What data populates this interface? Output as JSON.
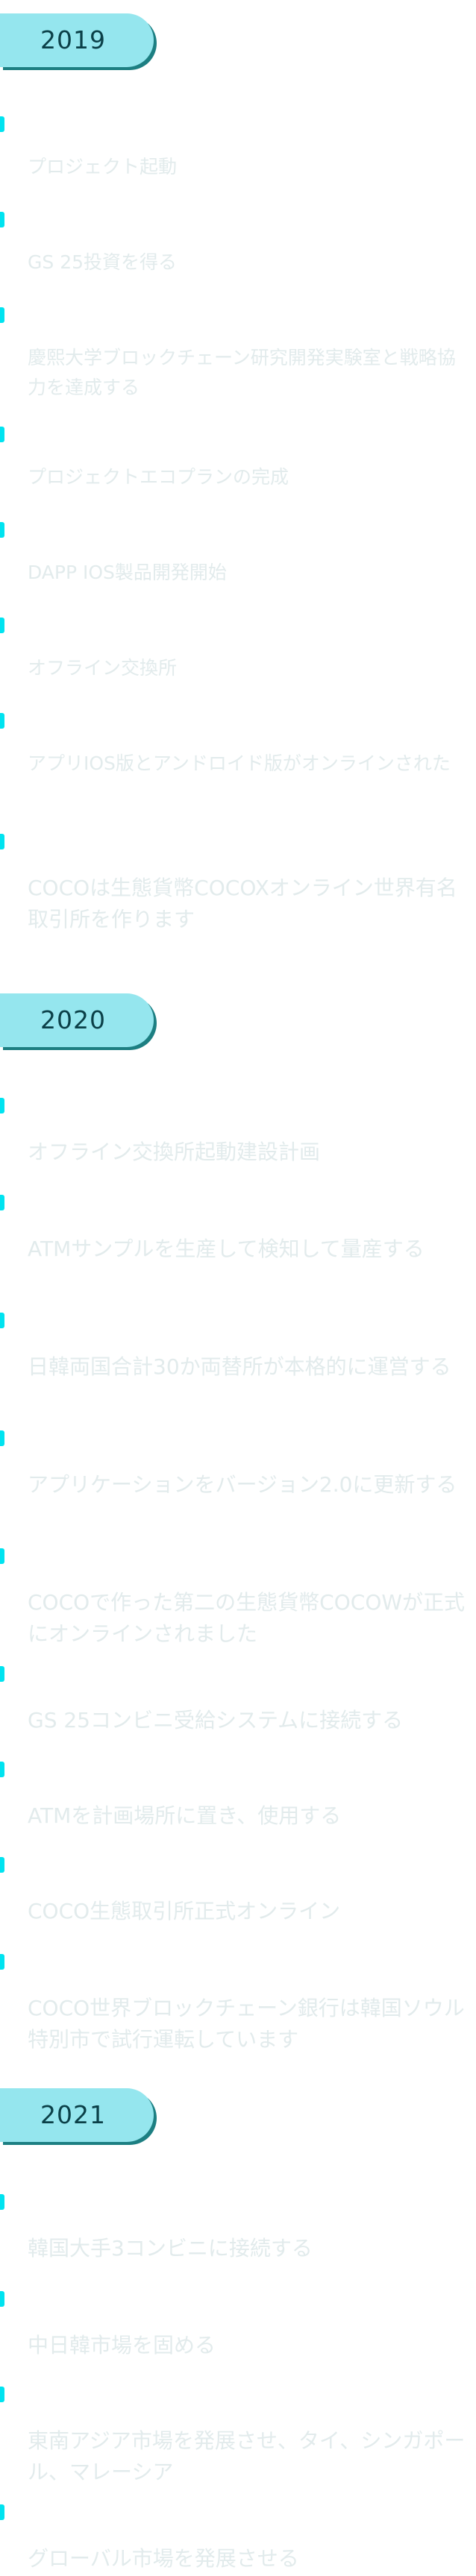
{
  "years": [
    {
      "year": "2019",
      "events": [
        "プロジェクト起動",
        "GS 25投資を得る",
        "慶熙大学ブロックチェーン研究開発実験室と戦略協力を達成する",
        "プロジェクトエコプランの完成",
        "DAPP IOS製品開発開始",
        "オフライン交換所",
        "アプリIOS版とアンドロイド版がオンラインされた",
        "COCOは生態貨幣COCOXオンライン世界有名取引所を作ります"
      ]
    },
    {
      "year": "2020",
      "events": [
        "オフライン交換所起動建設計画",
        "ATMサンプルを生産して検知して量産する",
        "日韓両国合計30か両替所が本格的に運営する",
        "アプリケーションをバージョン2.0に更新する",
        "COCOで作った第二の生態貨幣COCOWが正式にオンラインされました",
        "GS 25コンビニ受給システムに接続する",
        "ATMを計画場所に置き、使用する",
        "COCO生態取引所正式オンライン",
        "COCO世界ブロックチェーン銀行は韓国ソウル特別市で試行運転しています"
      ]
    },
    {
      "year": "2021",
      "events": [
        "韓国大手3コンビニに接続する",
        "中日韓市場を固める",
        "東南アジア市場を発展させ、タイ、シンガポール、マレーシア",
        "グローバル市場を発展させる"
      ]
    }
  ]
}
